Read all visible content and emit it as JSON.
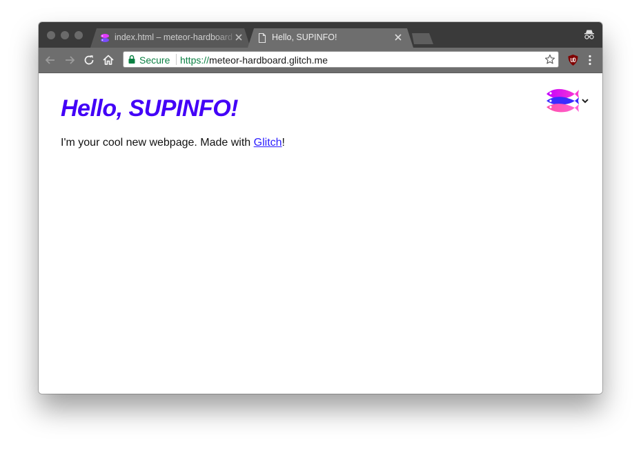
{
  "browser": {
    "tabs": [
      {
        "title": "index.html – meteor-hardboard",
        "active": false,
        "favicon": "glitch-fish-icon"
      },
      {
        "title": "Hello, SUPINFO!",
        "active": true,
        "favicon": "document-icon"
      }
    ],
    "address_bar": {
      "security_label": "Secure",
      "url_scheme": "https://",
      "url_host": "meteor-hardboard.glitch.me"
    }
  },
  "page": {
    "heading": "Hello, SUPINFO!",
    "paragraph_prefix": "I'm your cool new webpage. Made with ",
    "link_text": "Glitch",
    "paragraph_suffix": "!"
  },
  "colors": {
    "heading": "#4300f7",
    "link": "#2a1cff",
    "secure_green": "#0b8043",
    "tab_active": "#6e6e6e",
    "tab_bar": "#3a3a3a"
  }
}
